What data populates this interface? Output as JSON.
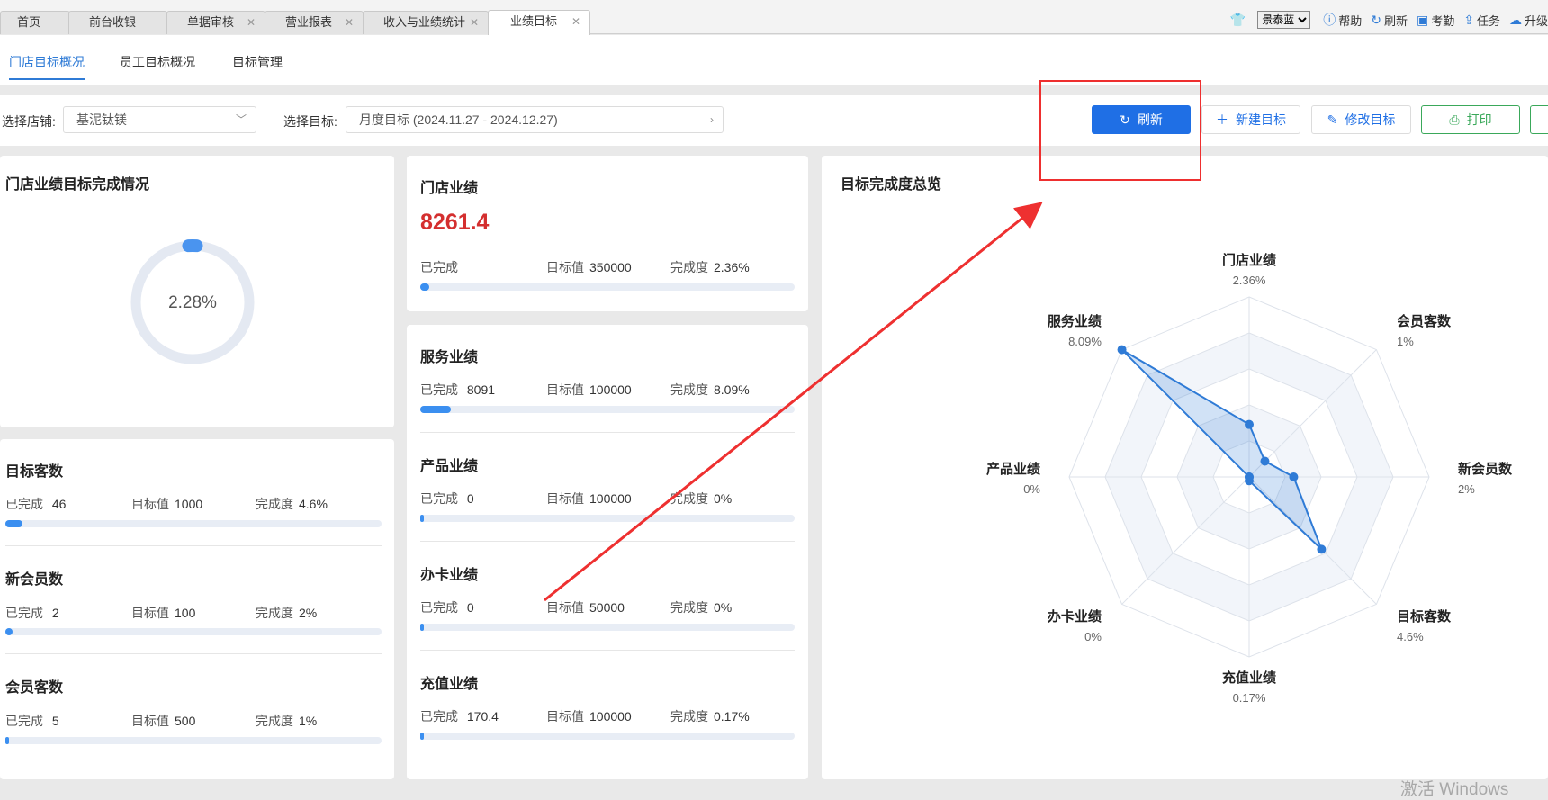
{
  "tabs": [
    {
      "label": "首页",
      "closable": false,
      "active": false
    },
    {
      "label": "前台收银",
      "closable": false,
      "active": false
    },
    {
      "label": "单据审核",
      "closable": true,
      "active": false
    },
    {
      "label": "营业报表",
      "closable": true,
      "active": false
    },
    {
      "label": "收入与业绩统计",
      "closable": true,
      "active": false
    },
    {
      "label": "业绩目标",
      "closable": true,
      "active": true
    }
  ],
  "tools": {
    "skin_icon": "shirt-icon",
    "skin_value": "景泰蓝",
    "help": "帮助",
    "refresh": "刷新",
    "attendance": "考勤",
    "task": "任务",
    "upgrade": "升级"
  },
  "subtabs": [
    "门店目标概况",
    "员工目标概况",
    "目标管理"
  ],
  "filters": {
    "store_label": "选择店铺:",
    "store_value": "基泥钛镁",
    "target_label": "选择目标:",
    "target_value": "月度目标 (2024.11.27 - 2024.12.27)"
  },
  "actions": {
    "refresh": "刷新",
    "new_target": "新建目标",
    "edit_target": "修改目标",
    "print": "打印"
  },
  "overall": {
    "title": "门店业绩目标完成情况",
    "percent_text": "2.28%",
    "percent": 2.28
  },
  "labels": {
    "done": "已完成",
    "target": "目标值",
    "rate": "完成度"
  },
  "store_sales": {
    "title": "门店业绩",
    "value": "8261.4",
    "done": "",
    "target": "350000",
    "rate": "2.36%",
    "fraction": 0.0236
  },
  "sales_items": [
    {
      "title": "服务业绩",
      "done": "8091",
      "target": "100000",
      "rate": "8.09%",
      "fraction": 0.0809
    },
    {
      "title": "产品业绩",
      "done": "0",
      "target": "100000",
      "rate": "0%",
      "fraction": 0
    },
    {
      "title": "办卡业绩",
      "done": "0",
      "target": "50000",
      "rate": "0%",
      "fraction": 0
    },
    {
      "title": "充值业绩",
      "done": "170.4",
      "target": "100000",
      "rate": "0.17%",
      "fraction": 0.0017
    }
  ],
  "customer_items": [
    {
      "title": "目标客数",
      "done": "46",
      "target": "1000",
      "rate": "4.6%",
      "fraction": 0.046
    },
    {
      "title": "新会员数",
      "done": "2",
      "target": "100",
      "rate": "2%",
      "fraction": 0.02
    },
    {
      "title": "会员客数",
      "done": "5",
      "target": "500",
      "rate": "1%",
      "fraction": 0.01
    }
  ],
  "radar": {
    "title": "目标完成度总览",
    "color": "#2f7bd6"
  },
  "chart_data": {
    "type": "radar",
    "title": "目标完成度总览",
    "categories": [
      "门店业绩",
      "会员客数",
      "新会员数",
      "目标客数",
      "充值业绩",
      "办卡业绩",
      "产品业绩",
      "服务业绩"
    ],
    "category_labels": [
      "2.36%",
      "1%",
      "2%",
      "4.6%",
      "0.17%",
      "0%",
      "0%",
      "8.09%"
    ],
    "series": [
      {
        "values": [
          2.36,
          1,
          2,
          4.6,
          0.17,
          0,
          0,
          8.09
        ]
      }
    ],
    "rmax": 8.09
  },
  "watermark": "激活 Windows"
}
